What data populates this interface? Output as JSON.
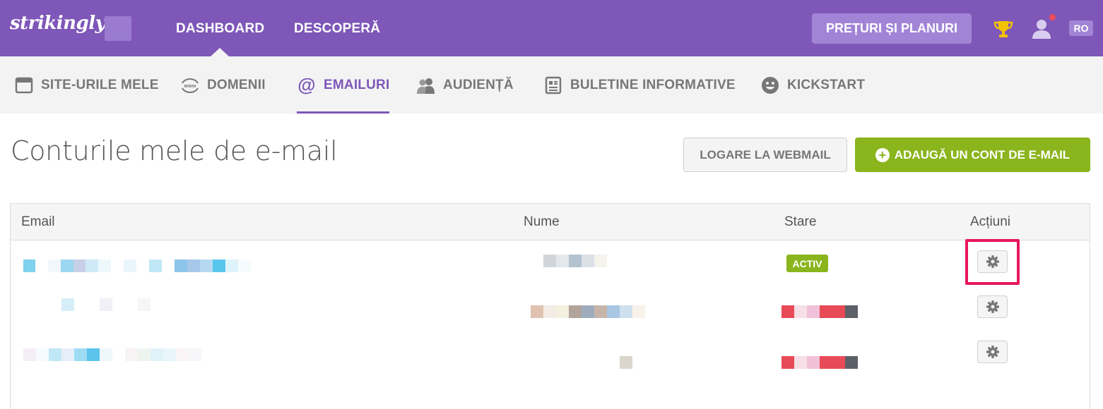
{
  "header": {
    "logo": "strikingly",
    "nav": [
      {
        "label": "DASHBOARD"
      },
      {
        "label": "DESCOPERĂ"
      }
    ],
    "pricing_button": "PREȚURI ȘI PLANURI",
    "language": "RO",
    "icons": [
      "trophy-icon",
      "user-icon"
    ]
  },
  "subnav": {
    "items": [
      {
        "label": "SITE-URILE MELE",
        "icon": "browser-window-icon"
      },
      {
        "label": "DOMENII",
        "icon": "www-globe-icon"
      },
      {
        "label": "EMAILURI",
        "icon": "at-sign-icon",
        "active": true
      },
      {
        "label": "AUDIENȚĂ",
        "icon": "people-icon"
      },
      {
        "label": "BULETINE INFORMATIVE",
        "icon": "newsletter-icon"
      },
      {
        "label": "KICKSTART",
        "icon": "smiley-icon"
      }
    ],
    "active_color": "#7e57b8"
  },
  "page": {
    "title": "Conturile mele de e-mail",
    "webmail_button": "LOGARE LA WEBMAIL",
    "add_button": "ADAUGĂ UN CONT DE E-MAIL"
  },
  "table": {
    "columns": [
      "Email",
      "Nume",
      "Stare",
      "Acțiuni"
    ],
    "rows": [
      {
        "status": "ACTIV",
        "action_icon": "gear-icon"
      },
      {
        "status": "",
        "action_icon": "gear-icon"
      },
      {
        "status": "",
        "action_icon": "gear-icon"
      }
    ]
  },
  "colors": {
    "brand_purple": "#7e57b8",
    "accent_green": "#8ab51d",
    "highlight": "#e8175d"
  }
}
